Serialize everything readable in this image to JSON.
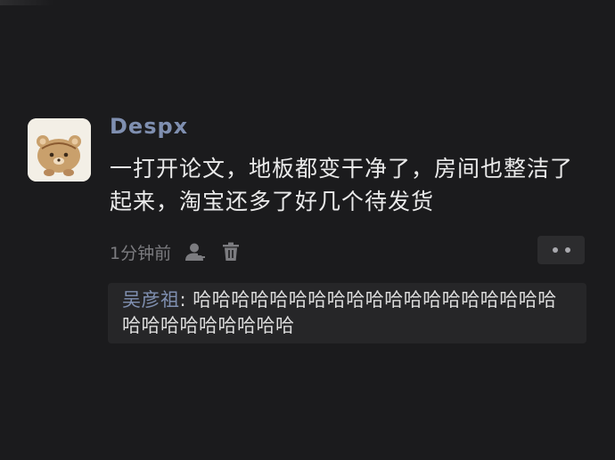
{
  "post": {
    "username": "Despx",
    "content": "一打开论文，地板都变干净了，房间也整洁了起来，淘宝还多了好几个待发货",
    "time": "1分钟前"
  },
  "comment": {
    "author": "吴彦祖",
    "separator": ": ",
    "text": "哈哈哈哈哈哈哈哈哈哈哈哈哈哈哈哈哈哈哈哈哈哈哈哈哈哈哈哈"
  },
  "icons": {
    "user": "person-icon",
    "delete": "trash-icon",
    "more": "more-dots-icon"
  },
  "colors": {
    "background": "#1b1b1d",
    "username": "#7f8fb0",
    "text": "#eaeaea",
    "muted": "#7c7c80",
    "panel": "#262628"
  }
}
